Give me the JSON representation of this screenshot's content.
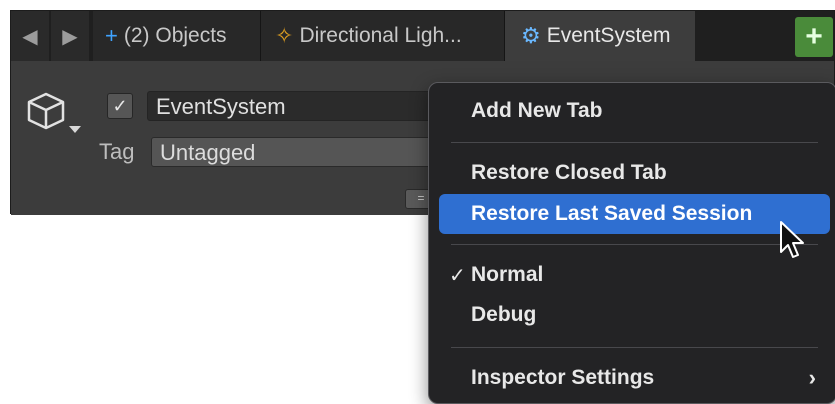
{
  "tabs": [
    {
      "label": "(2) Objects",
      "icon": "plus-icon",
      "active": false
    },
    {
      "label": "Directional Ligh...",
      "icon": "light-icon",
      "active": false
    },
    {
      "label": "EventSystem",
      "icon": "event-system-icon",
      "active": true
    }
  ],
  "nav": {
    "prev_icon": "prev-tab-icon",
    "next_icon": "next-tab-icon",
    "add_icon": "add-tab-icon"
  },
  "object": {
    "name": "EventSystem",
    "active_checked": true,
    "tag_label": "Tag",
    "tag_value": "Untagged"
  },
  "menu": {
    "items": [
      {
        "label": "Add New Tab"
      },
      {
        "label": "Restore Closed Tab"
      },
      {
        "label": "Restore Last Saved Session",
        "highlighted": true
      },
      {
        "label": "Normal",
        "checked": true
      },
      {
        "label": "Debug"
      },
      {
        "label": "Inspector Settings",
        "submenu": true
      }
    ]
  },
  "colors": {
    "highlight": "#2f6fd1",
    "add_button": "#4a8b3a",
    "panel": "#383838"
  }
}
